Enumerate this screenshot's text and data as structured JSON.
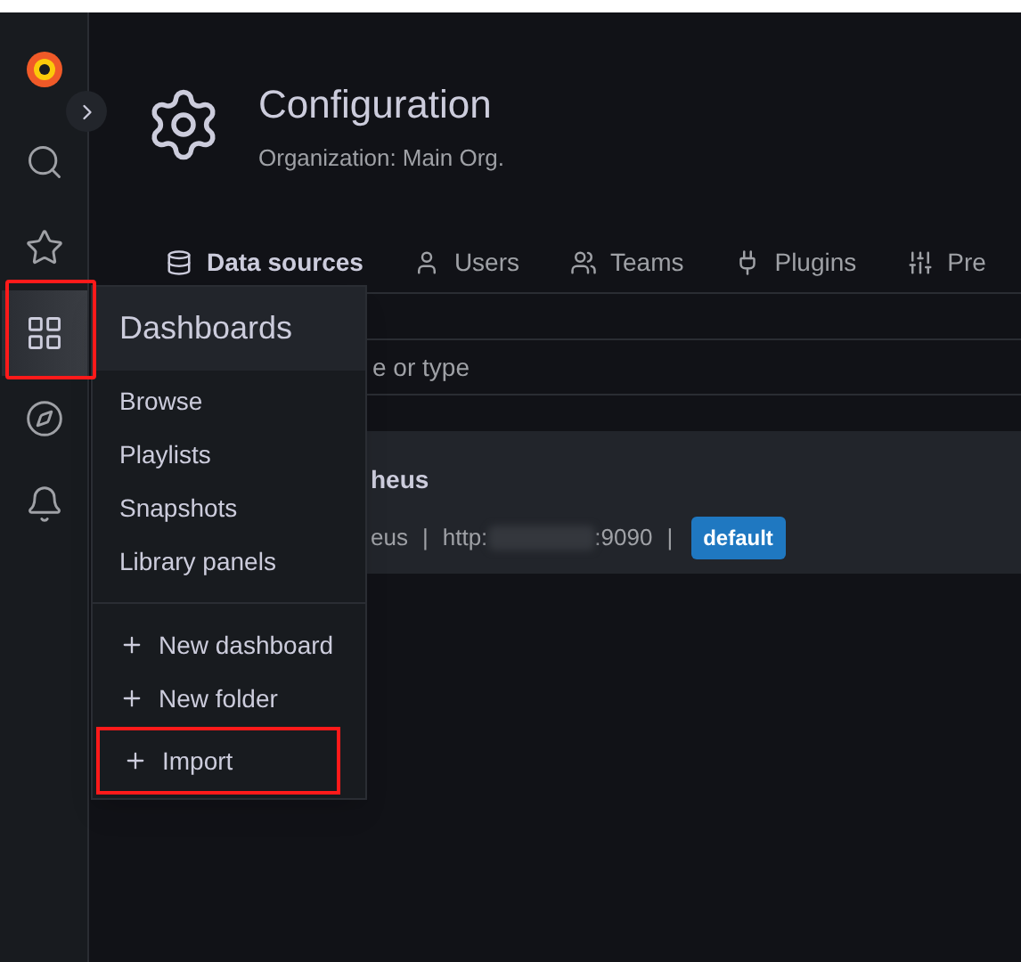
{
  "sidebar": {
    "items": [
      {
        "kind": "search",
        "selected": false
      },
      {
        "kind": "star",
        "selected": false
      },
      {
        "kind": "dashboards",
        "selected": true
      },
      {
        "kind": "explore",
        "selected": false
      },
      {
        "kind": "alerting",
        "selected": false
      }
    ]
  },
  "header": {
    "title": "Configuration",
    "subtitle": "Organization: Main Org."
  },
  "tabs": [
    {
      "label": "Data sources",
      "kind": "database",
      "selected": true
    },
    {
      "label": "Users",
      "kind": "user",
      "selected": false
    },
    {
      "label": "Teams",
      "kind": "users",
      "selected": false
    },
    {
      "label": "Plugins",
      "kind": "plug",
      "selected": false
    },
    {
      "label": "Pre",
      "kind": "sliders",
      "selected": false
    }
  ],
  "search": {
    "placeholder": "e or type"
  },
  "datasource": {
    "name": "heus",
    "type": "eus",
    "separator_1": "|",
    "url_start": "http:",
    "url_end": ":9090",
    "separator_2": "|",
    "badge": "default"
  },
  "menu": {
    "title": "Dashboards",
    "items": [
      {
        "label": "Browse",
        "kind": "link"
      },
      {
        "label": "Playlists",
        "kind": "link"
      },
      {
        "label": "Snapshots",
        "kind": "link"
      },
      {
        "label": "Library panels",
        "kind": "link"
      },
      {
        "kind": "divider"
      },
      {
        "label": "New dashboard",
        "kind": "create",
        "highlighted": false
      },
      {
        "label": "New folder",
        "kind": "create",
        "highlighted": false
      },
      {
        "label": "Import",
        "kind": "create",
        "highlighted": true
      }
    ]
  }
}
